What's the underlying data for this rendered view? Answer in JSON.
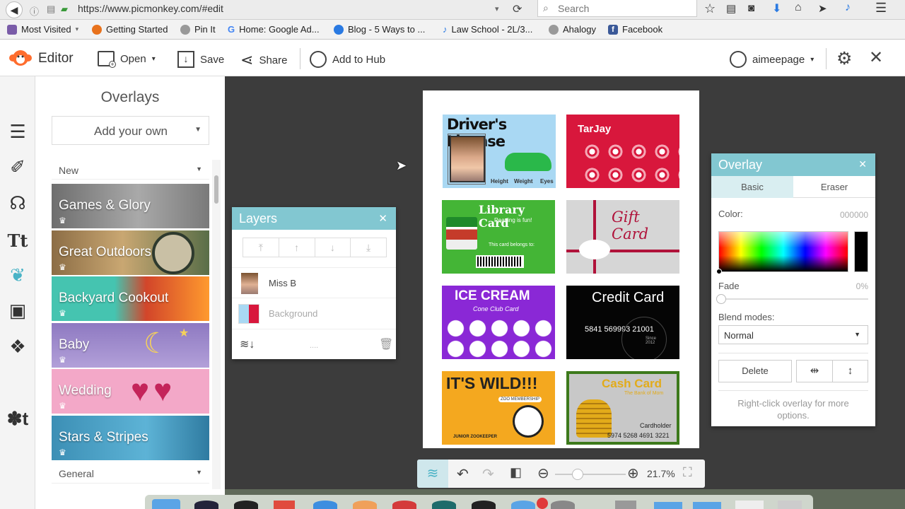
{
  "browser": {
    "url": "https://www.picmonkey.com/#edit",
    "search_placeholder": "Search",
    "bookmarks": [
      "Most Visited",
      "Getting Started",
      "Pin It",
      "Home: Google Ad...",
      "Blog - 5 Ways to ...",
      "Law School - 2L/3...",
      "Ahalogy",
      "Facebook"
    ]
  },
  "header": {
    "app_name": "Editor",
    "open_label": "Open",
    "save_label": "Save",
    "share_label": "Share",
    "hub_label": "Add to Hub",
    "username": "aimeepage"
  },
  "overlays_panel": {
    "title": "Overlays",
    "add_your_own": "Add your own",
    "section_new": "New",
    "section_general": "General",
    "categories": [
      {
        "label": "Games & Glory",
        "color": "#8f8f8f"
      },
      {
        "label": "Great Outdoors",
        "color": "#9b7a55"
      },
      {
        "label": "Backyard Cookout",
        "color": "#45c4b0"
      },
      {
        "label": "Baby",
        "color": "#9c86c9"
      },
      {
        "label": "Wedding",
        "color": "#f2a9c9"
      },
      {
        "label": "Stars & Stripes",
        "color": "#3c8fb5"
      }
    ]
  },
  "cards": {
    "drivers_license": {
      "title": "Driver's License",
      "height": "Height",
      "weight": "Weight",
      "eyes": "Eyes"
    },
    "tarjay": {
      "title": "TarJay"
    },
    "library": {
      "title": "Library Card",
      "sub": "Reading is fun!",
      "belongs": "This card belongs to:"
    },
    "gift": {
      "title": "Gift Card"
    },
    "ice_cream": {
      "title": "ICE CREAM",
      "sub": "Cone Club Card"
    },
    "credit": {
      "title": "Credit Card",
      "number": "5841 569993 21001",
      "since": "Since 2012"
    },
    "wild": {
      "title": "IT'S WILD!!!",
      "sub": "ZOO MEMBERSHIP",
      "role": "JUNIOR ZOOKEEPER"
    },
    "cash": {
      "title": "Cash Card",
      "sub": "The Bank of Mom",
      "holder": "Cardholder",
      "number": "5974 5268 4691 3221"
    }
  },
  "layers_panel": {
    "title": "Layers",
    "items": [
      {
        "name": "Miss B",
        "active": true
      },
      {
        "name": "Background",
        "active": false
      }
    ]
  },
  "overlay_panel": {
    "title": "Overlay",
    "tab_basic": "Basic",
    "tab_eraser": "Eraser",
    "color_label": "Color:",
    "color_value": "000000",
    "fade_label": "Fade",
    "fade_value": "0%",
    "blend_label": "Blend modes:",
    "blend_value": "Normal",
    "delete_label": "Delete",
    "hint": "Right-click overlay for more options."
  },
  "zoom": {
    "value": "21.7%"
  },
  "colors": {
    "accent": "#82c7d1",
    "logo": "#ff6d2e"
  }
}
